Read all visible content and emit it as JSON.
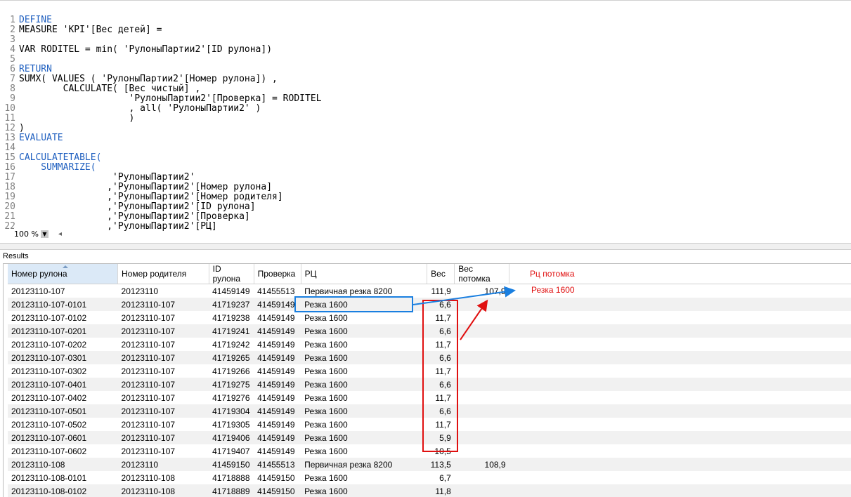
{
  "editor": {
    "lines": [
      {
        "n": "1",
        "t": "DEFINE",
        "k": "kw"
      },
      {
        "n": "2",
        "t": "MEASURE 'KPI'[Вес детей] =",
        "k": ""
      },
      {
        "n": "3",
        "t": "",
        "k": ""
      },
      {
        "n": "4",
        "t": "VAR RODITEL = min( 'РулоныПартии2'[ID рулона])",
        "k": ""
      },
      {
        "n": "5",
        "t": "",
        "k": ""
      },
      {
        "n": "6",
        "t": "RETURN",
        "k": "kw"
      },
      {
        "n": "7",
        "t": "SUMX( VALUES ( 'РулоныПартии2'[Номер рулона]) ,",
        "k": ""
      },
      {
        "n": "8",
        "t": "        CALCULATE( [Вес чистый] ,",
        "k": ""
      },
      {
        "n": "9",
        "t": "                    'РулоныПартии2'[Проверка] = RODITEL",
        "k": ""
      },
      {
        "n": "10",
        "t": "                    , all( 'РулоныПартии2' )",
        "k": ""
      },
      {
        "n": "11",
        "t": "                    )",
        "k": ""
      },
      {
        "n": "12",
        "t": ")",
        "k": ""
      },
      {
        "n": "13",
        "t": "EVALUATE",
        "k": "kw"
      },
      {
        "n": "14",
        "t": "",
        "k": ""
      },
      {
        "n": "15",
        "t": "CALCULATETABLE(",
        "k": "kw"
      },
      {
        "n": "16",
        "t": "    SUMMARIZE(",
        "k": "kw"
      },
      {
        "n": "17",
        "t": "                 'РулоныПартии2'",
        "k": ""
      },
      {
        "n": "18",
        "t": "                ,'РулоныПартии2'[Номер рулона]",
        "k": ""
      },
      {
        "n": "19",
        "t": "                ,'РулоныПартии2'[Номер родителя]",
        "k": ""
      },
      {
        "n": "20",
        "t": "                ,'РулоныПартии2'[ID рулона]",
        "k": ""
      },
      {
        "n": "21",
        "t": "                ,'РулоныПартии2'[Проверка]",
        "k": ""
      },
      {
        "n": "22",
        "t": "                ,'РулоныПартии2'[РЦ]",
        "k": ""
      }
    ],
    "zoom": "100 %"
  },
  "results": {
    "label": "Results",
    "columns": [
      "Номер рулона",
      "Номер родителя",
      "ID рулона",
      "Проверка",
      "РЦ",
      "Вес",
      "Вес потомка"
    ],
    "rows": [
      [
        "20123110-107",
        "20123110",
        "41459149",
        "41455513",
        "Первичная резка 8200",
        "111,9",
        "107,9"
      ],
      [
        "20123110-107-0101",
        "20123110-107",
        "41719237",
        "41459149",
        "Резка 1600",
        "6,6",
        ""
      ],
      [
        "20123110-107-0102",
        "20123110-107",
        "41719238",
        "41459149",
        "Резка 1600",
        "11,7",
        ""
      ],
      [
        "20123110-107-0201",
        "20123110-107",
        "41719241",
        "41459149",
        "Резка 1600",
        "6,6",
        ""
      ],
      [
        "20123110-107-0202",
        "20123110-107",
        "41719242",
        "41459149",
        "Резка 1600",
        "11,7",
        ""
      ],
      [
        "20123110-107-0301",
        "20123110-107",
        "41719265",
        "41459149",
        "Резка 1600",
        "6,6",
        ""
      ],
      [
        "20123110-107-0302",
        "20123110-107",
        "41719266",
        "41459149",
        "Резка 1600",
        "11,7",
        ""
      ],
      [
        "20123110-107-0401",
        "20123110-107",
        "41719275",
        "41459149",
        "Резка 1600",
        "6,6",
        ""
      ],
      [
        "20123110-107-0402",
        "20123110-107",
        "41719276",
        "41459149",
        "Резка 1600",
        "11,7",
        ""
      ],
      [
        "20123110-107-0501",
        "20123110-107",
        "41719304",
        "41459149",
        "Резка 1600",
        "6,6",
        ""
      ],
      [
        "20123110-107-0502",
        "20123110-107",
        "41719305",
        "41459149",
        "Резка 1600",
        "11,7",
        ""
      ],
      [
        "20123110-107-0601",
        "20123110-107",
        "41719406",
        "41459149",
        "Резка 1600",
        "5,9",
        ""
      ],
      [
        "20123110-107-0602",
        "20123110-107",
        "41719407",
        "41459149",
        "Резка 1600",
        "10,5",
        ""
      ],
      [
        "20123110-108",
        "20123110",
        "41459150",
        "41455513",
        "Первичная резка 8200",
        "113,5",
        "108,9"
      ],
      [
        "20123110-108-0101",
        "20123110-108",
        "41718888",
        "41459150",
        "Резка 1600",
        "6,7",
        ""
      ],
      [
        "20123110-108-0102",
        "20123110-108",
        "41718889",
        "41459150",
        "Резка 1600",
        "11,8",
        ""
      ]
    ]
  },
  "annotations": {
    "label1": "Рц потомка",
    "label2": "Резка 1600",
    "red": "#e01010",
    "blue": "#1a7fe0"
  }
}
